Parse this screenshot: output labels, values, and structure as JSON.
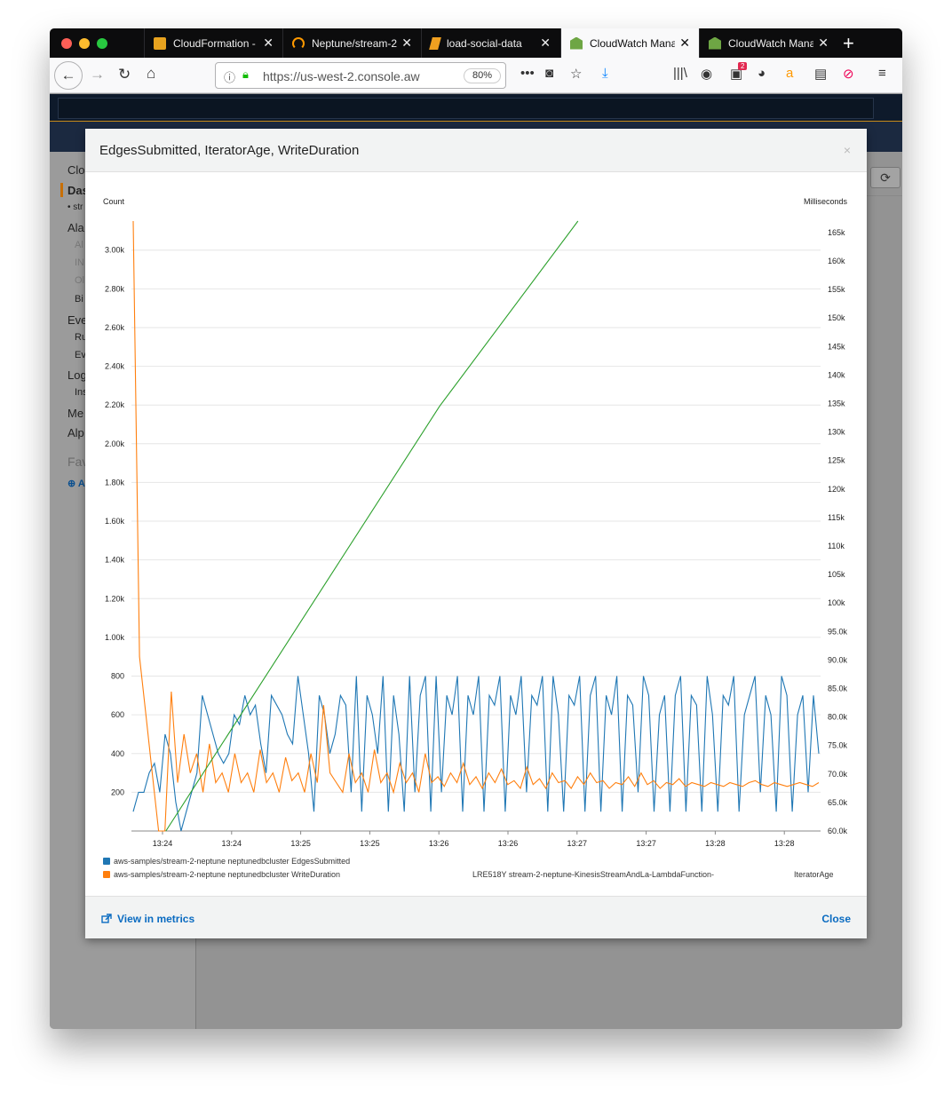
{
  "browser": {
    "tabs": [
      {
        "title": "CloudFormation - ",
        "icon_color": "#e8a31f"
      },
      {
        "title": "Neptune/stream-2",
        "icon_color": "#ff9900"
      },
      {
        "title": "load-social-data",
        "icon_color": "#f0a020"
      },
      {
        "title": "CloudWatch Mana",
        "icon_color": "#6ea644",
        "active": true
      },
      {
        "title": "CloudWatch Mana",
        "icon_color": "#6ea644"
      }
    ],
    "url": "https://us-west-2.console.aw",
    "zoom": "80%",
    "badge_count": "2"
  },
  "sidebar": {
    "items": [
      "Clo",
      "Das",
      "• str",
      "Ala",
      "Al",
      "IN",
      "Ol",
      "Bi",
      "Eve",
      "Ru",
      "Ev",
      "Log",
      "Ins",
      "Me",
      "Alp",
      "Fav",
      "A"
    ]
  },
  "modal": {
    "title": "EdgesSubmitted, IteratorAge, WriteDuration",
    "close_x": "×",
    "view_in_metrics": "View in metrics",
    "close": "Close"
  },
  "chart_data": {
    "type": "line",
    "ylabel_left": "Count",
    "ylabel_right": "Milliseconds",
    "x_ticks": [
      "13:24",
      "13:24",
      "13:25",
      "13:25",
      "13:26",
      "13:26",
      "13:27",
      "13:27",
      "13:28",
      "13:28"
    ],
    "y_left_ticks": [
      "200",
      "400",
      "600",
      "800",
      "1.00k",
      "1.20k",
      "1.40k",
      "1.60k",
      "1.80k",
      "2.00k",
      "2.20k",
      "2.40k",
      "2.60k",
      "2.80k",
      "3.00k"
    ],
    "y_right_ticks": [
      "60.0k",
      "65.0k",
      "70.0k",
      "75.0k",
      "80.0k",
      "85.0k",
      "90.0k",
      "95.0k",
      "100k",
      "105k",
      "110k",
      "115k",
      "120k",
      "125k",
      "130k",
      "135k",
      "140k",
      "145k",
      "150k",
      "155k",
      "160k",
      "165k"
    ],
    "ylim_left": [
      0,
      3150
    ],
    "ylim_right": [
      60000,
      167000
    ],
    "grid": true,
    "series": [
      {
        "name": "aws-samples/stream-2-neptune neptunedbcluster EdgesSubmitted",
        "axis": "left",
        "color": "#1f77b4",
        "values": [
          100,
          200,
          200,
          300,
          350,
          200,
          500,
          400,
          150,
          0,
          100,
          200,
          300,
          700,
          600,
          500,
          400,
          350,
          400,
          600,
          550,
          700,
          600,
          650,
          450,
          300,
          700,
          650,
          600,
          500,
          450,
          800,
          600,
          400,
          100,
          700,
          600,
          400,
          500,
          700,
          650,
          200,
          800,
          100,
          700,
          600,
          400,
          800,
          100,
          700,
          500,
          100,
          800,
          200,
          700,
          800,
          100,
          800,
          200,
          700,
          600,
          800,
          100,
          700,
          600,
          800,
          100,
          700,
          650,
          800,
          100,
          700,
          600,
          800,
          200,
          700,
          650,
          800,
          100,
          800,
          600,
          100,
          700,
          650,
          800,
          100,
          700,
          800,
          100,
          700,
          600,
          800,
          100,
          700,
          650,
          200,
          800,
          700,
          100,
          600,
          700,
          100,
          700,
          800,
          100,
          700,
          650,
          100,
          800,
          600,
          100,
          700,
          650,
          800,
          100,
          600,
          700,
          800,
          200,
          700,
          600,
          100,
          800,
          700,
          100,
          600,
          700,
          200,
          700,
          400
        ]
      },
      {
        "name": "aws-samples/stream-2-neptune neptunedbcluster WriteDuration",
        "axis": "left",
        "color": "#ff7f0e",
        "values": [
          3150,
          900,
          600,
          300,
          0,
          0,
          720,
          250,
          500,
          300,
          400,
          200,
          450,
          250,
          300,
          200,
          400,
          250,
          300,
          200,
          420,
          250,
          300,
          200,
          380,
          260,
          300,
          200,
          400,
          250,
          650,
          300,
          250,
          200,
          400,
          250,
          300,
          200,
          420,
          250,
          300,
          200,
          350,
          250,
          300,
          200,
          400,
          250,
          280,
          230,
          300,
          250,
          350,
          240,
          280,
          220,
          300,
          250,
          320,
          240,
          260,
          220,
          330,
          240,
          270,
          220,
          300,
          250,
          260,
          220,
          280,
          240,
          300,
          250,
          260,
          220,
          250,
          240,
          280,
          230,
          300,
          240,
          260,
          220,
          250,
          240,
          270,
          230,
          250,
          240,
          230,
          250,
          240,
          230,
          250,
          240,
          230,
          250,
          260,
          240,
          230,
          250,
          240,
          230,
          240,
          250,
          240,
          230,
          250
        ]
      },
      {
        "name": "LRE518Y stream-2-neptune-KinesisStreamAndLa-LambdaFunction-",
        "name_suffix": "IteratorAge",
        "axis": "right",
        "color": "#2ca02c",
        "x_frac": [
          0.05,
          0.447,
          0.648
        ],
        "values": [
          60000,
          134500,
          167000
        ]
      }
    ]
  }
}
